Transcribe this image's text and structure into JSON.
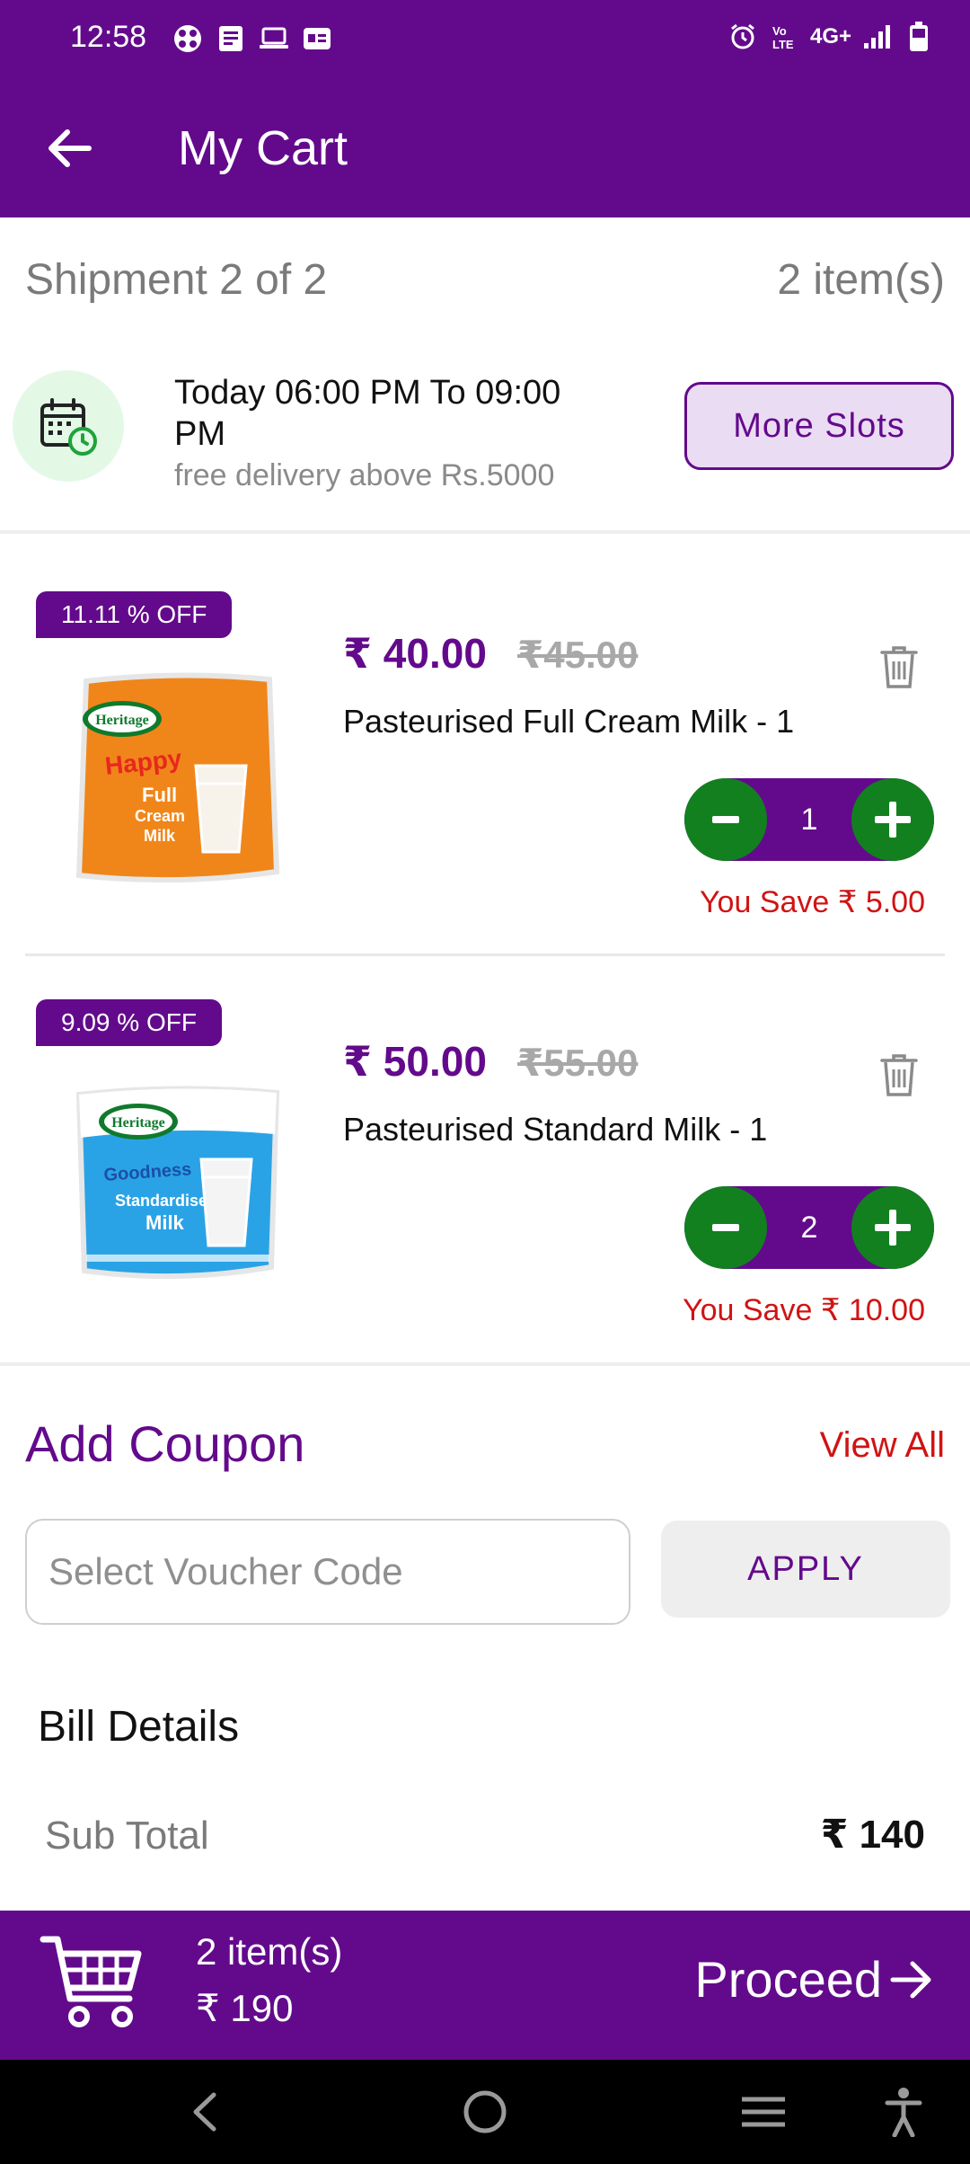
{
  "status_bar": {
    "time": "12:58",
    "network": "4G+",
    "left_icons": [
      "settings-icon",
      "notes-icon",
      "laptop-icon",
      "card-icon"
    ],
    "right_icons": [
      "alarm-icon",
      "volte-icon",
      "signal-icon",
      "battery-icon"
    ]
  },
  "app_bar": {
    "title": "My Cart",
    "back_icon": "arrow-left-icon"
  },
  "shipment": {
    "label": "Shipment 2 of 2",
    "count": "2 item(s)",
    "slot_time": "Today 06:00 PM To 09:00 PM",
    "slot_note": "free delivery above Rs.5000",
    "more_slots_label": "More Slots",
    "slot_icon": "calendar-clock-icon"
  },
  "items": [
    {
      "discount": "11.11 % OFF",
      "price": "₹ 40.00",
      "mrp": "₹45.00",
      "name": "Pasteurised Full Cream Milk - 1",
      "qty": "1",
      "save": "You Save ₹ 5.00",
      "pack_color": "#F0861A",
      "brand": "Heritage",
      "pack_text": "Happy Full Cream Milk"
    },
    {
      "discount": "9.09 % OFF",
      "price": "₹ 50.00",
      "mrp": "₹55.00",
      "name": "Pasteurised Standard Milk - 1",
      "qty": "2",
      "save": "You Save ₹ 10.00",
      "pack_color": "#2AA3E6",
      "brand": "Heritage",
      "pack_text": "Goodness Standardised Milk"
    }
  ],
  "coupon": {
    "title": "Add Coupon",
    "view_all": "View All",
    "placeholder": "Select Voucher Code",
    "apply": "APPLY"
  },
  "bill": {
    "title": "Bill Details",
    "subtotal_label": "Sub Total",
    "subtotal_value": "₹ 140"
  },
  "summary": {
    "items": "2 item(s)",
    "total": "₹ 190",
    "proceed": "Proceed"
  },
  "colors": {
    "primary": "#630A8C",
    "stepper_green": "#12801F",
    "save_red": "#D11313"
  }
}
